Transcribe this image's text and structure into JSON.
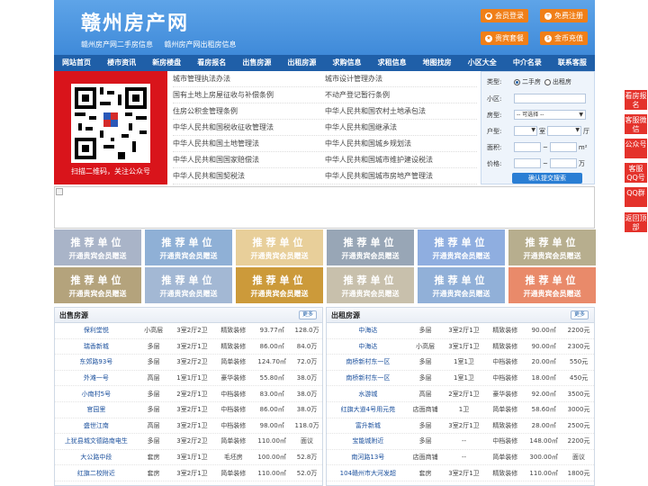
{
  "header": {
    "logo": "赣州房产网",
    "sublinks": [
      "赣州房产网二手房信息",
      "赣州房产网出租房信息"
    ],
    "buttons": [
      {
        "label": "会员登录",
        "icon": "user-icon"
      },
      {
        "label": "免费注册",
        "icon": "register-icon"
      },
      {
        "label": "贵宾套餐",
        "icon": "vip-icon"
      },
      {
        "label": "金币充值",
        "icon": "coin-icon"
      }
    ]
  },
  "nav": [
    "网站首页",
    "楼市资讯",
    "新房楼盘",
    "看房报名",
    "出售房源",
    "出租房源",
    "求购信息",
    "求租信息",
    "地图找房",
    "小区大全",
    "中介名录",
    "联系客服"
  ],
  "qr": {
    "caption": "扫描二维码，关注公众号"
  },
  "laws": [
    [
      "城市管理执法办法",
      "城市设计管理办法"
    ],
    [
      "国有土地上房屋征收与补偿条例",
      "不动产登记暂行条例"
    ],
    [
      "住房公积金管理条例",
      "中华人民共和国农村土地承包法"
    ],
    [
      "中华人民共和国税收征收管理法",
      "中华人民共和国继承法"
    ],
    [
      "中华人民共和国土地管理法",
      "中华人民共和国城乡规划法"
    ],
    [
      "中华人民共和国国家赔偿法",
      "中华人民共和国城市维护建设税法"
    ],
    [
      "中华人民共和国契税法",
      "中华人民共和国城市房地产管理法"
    ]
  ],
  "search": {
    "type_label": "类型:",
    "type_options": [
      "二手房",
      "出租房"
    ],
    "community_label": "小区:",
    "housetype_label": "房型:",
    "housetype_value": "-- 可选择 --",
    "layout_label": "户型:",
    "room_unit": "室",
    "hall_unit": "厅",
    "area_label": "面积:",
    "area_unit": "m²",
    "price_label": "价格:",
    "price_unit": "万",
    "range_sep": "~",
    "submit": "确认提交搜索"
  },
  "ad_tile": {
    "title": "推荐单位",
    "subtitle": "开通贵宾会员赠送"
  },
  "ad_colors": [
    "#a9b4c8",
    "#8fb0d6",
    "#e8cf9a",
    "#98a6b6",
    "#8faee0",
    "#b7ae8e",
    "#b4a37c",
    "#a3b8d4",
    "#cc9a3a",
    "#c8c0ac",
    "#91b0d8",
    "#e98a6a"
  ],
  "sale": {
    "title": "出售房源",
    "more": "更多",
    "rows": [
      [
        "保利堂悦",
        "小高层",
        "3室2厅2卫",
        "精致装修",
        "93.77㎡",
        "128.0万"
      ],
      [
        "瑞香新城",
        "多层",
        "3室2厅1卫",
        "精致装修",
        "86.00㎡",
        "84.0万"
      ],
      [
        "东郊路93号",
        "多层",
        "3室2厅2卫",
        "简单装修",
        "124.70㎡",
        "72.0万"
      ],
      [
        "外滩一号",
        "高层",
        "1室1厅1卫",
        "豪华装修",
        "55.80㎡",
        "38.0万"
      ],
      [
        "小南村5号",
        "多层",
        "2室2厅1卫",
        "中档装修",
        "83.00㎡",
        "38.0万"
      ],
      [
        "官园里",
        "多层",
        "3室2厅1卫",
        "中档装修",
        "86.00㎡",
        "38.0万"
      ],
      [
        "盛世江南",
        "高层",
        "3室2厅1卫",
        "中档装修",
        "98.00㎡",
        "118.0万"
      ],
      [
        "上犹县城文德路南电生",
        "多层",
        "3室2厅2卫",
        "简单装修",
        "110.00㎡",
        "面议"
      ],
      [
        "大公路中段",
        "套房",
        "3室1厅1卫",
        "毛坯房",
        "100.00㎡",
        "52.8万"
      ],
      [
        "红旗二校附近",
        "套房",
        "3室2厅1卫",
        "简单装修",
        "110.00㎡",
        "52.0万"
      ]
    ]
  },
  "rent": {
    "title": "出租房源",
    "more": "更多",
    "rows": [
      [
        "中海达",
        "多层",
        "3室2厅1卫",
        "精致装修",
        "90.00㎡",
        "2200元"
      ],
      [
        "中海达",
        "小高层",
        "3室1厅1卫",
        "精致装修",
        "90.00㎡",
        "2300元"
      ],
      [
        "南桥新村东一区",
        "多层",
        "1室1卫",
        "中档装修",
        "20.00㎡",
        "550元"
      ],
      [
        "南桥新村东一区",
        "多层",
        "1室1卫",
        "中档装修",
        "18.00㎡",
        "450元"
      ],
      [
        "水游城",
        "高层",
        "2室2厅1卫",
        "豪华装修",
        "92.00㎡",
        "3500元"
      ],
      [
        "红旗大道4号用元苑",
        "店面商铺",
        "1卫",
        "简单装修",
        "58.60㎡",
        "3000元"
      ],
      [
        "富升新城",
        "多层",
        "3室2厅1卫",
        "精致装修",
        "28.00㎡",
        "2500元"
      ],
      [
        "宝能城附近",
        "多层",
        "--",
        "中档装修",
        "148.00㎡",
        "2200元"
      ],
      [
        "南河路13号",
        "店面商铺",
        "--",
        "简单装修",
        "300.00㎡",
        "面议"
      ],
      [
        "104赣州市大河发超",
        "套房",
        "3室2厅1卫",
        "精致装修",
        "110.00㎡",
        "1800元"
      ]
    ]
  },
  "side": [
    "看房报名",
    "客服微信",
    "公众号",
    "客服QQ号",
    "QQ群",
    "返回顶部"
  ]
}
